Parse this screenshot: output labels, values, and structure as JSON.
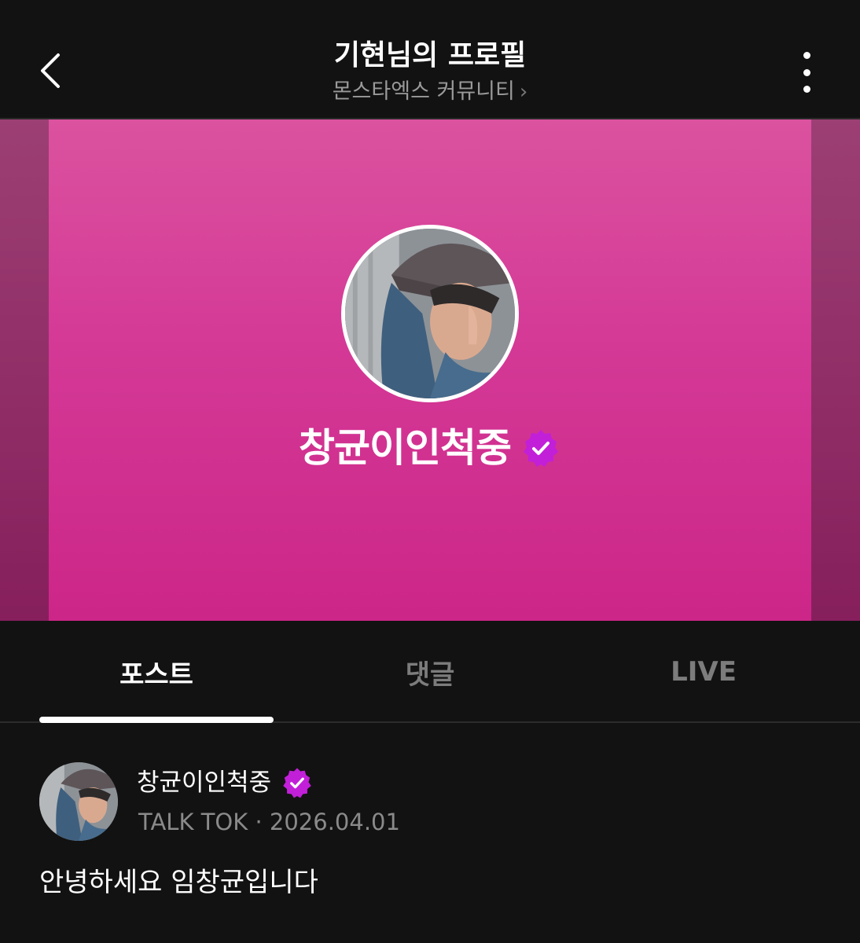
{
  "header": {
    "title": "기현님의 프로필",
    "community": "몬스타엑스 커뮤니티",
    "community_chevron": "›"
  },
  "profile": {
    "name": "창균이인척중",
    "verified": true,
    "banner_color": "#d43996",
    "badge_color": "#c21fd9"
  },
  "tabs": [
    {
      "label": "포스트",
      "active": true
    },
    {
      "label": "댓글",
      "active": false
    },
    {
      "label": "LIVE",
      "active": false
    }
  ],
  "post": {
    "author": "창균이인척중",
    "meta": "TALK TOK · 2026.04.01",
    "body": "안녕하세요 임창균입니다"
  },
  "icons": {
    "back": "chevron-left-icon",
    "more": "more-vertical-icon",
    "verified": "verified-badge-icon"
  }
}
